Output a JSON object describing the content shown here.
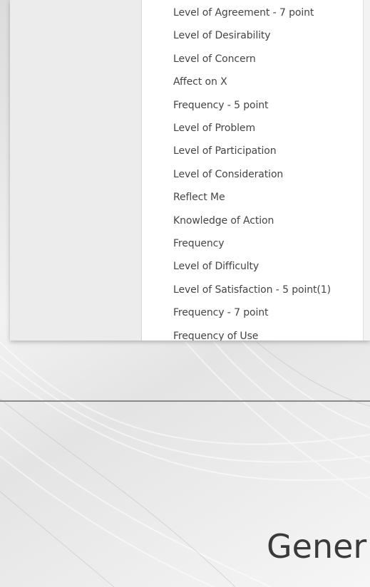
{
  "dropdown": {
    "items": [
      "Level of Agreement - 7 point",
      "Level of Desirability",
      "Level of Concern",
      "Affect on X",
      "Frequency - 5 point",
      "Level of Problem",
      "Level of Participation",
      "Level of Consideration",
      "Reflect Me",
      "Knowledge of Action",
      "Frequency",
      "Level of Difficulty",
      "Level of Satisfaction - 5 point(1)",
      "Frequency - 7 point",
      "Frequency of Use"
    ]
  },
  "background": {
    "title": "Gener"
  }
}
